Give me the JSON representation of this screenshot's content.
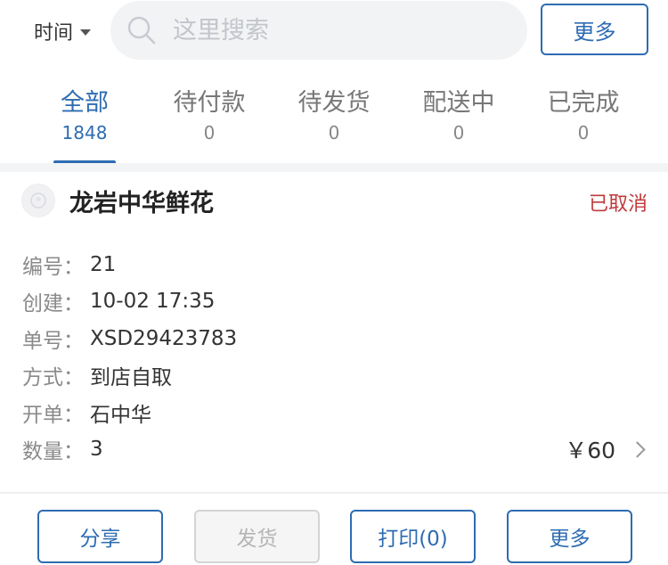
{
  "topbar": {
    "time_filter_label": "时间",
    "search_placeholder": "这里搜索",
    "more_label": "更多"
  },
  "tabs": [
    {
      "label": "全部",
      "count": "1848",
      "active": true
    },
    {
      "label": "待付款",
      "count": "0",
      "active": false
    },
    {
      "label": "待发货",
      "count": "0",
      "active": false
    },
    {
      "label": "配送中",
      "count": "0",
      "active": false
    },
    {
      "label": "已完成",
      "count": "0",
      "active": false
    }
  ],
  "order": {
    "store_name": "龙岩中华鲜花",
    "status": "已取消",
    "fields": [
      {
        "key": "编号：",
        "value": "21"
      },
      {
        "key": "创建：",
        "value": "10-02 17:35"
      },
      {
        "key": "单号：",
        "value": "XSD29423783"
      },
      {
        "key": "方式：",
        "value": "到店自取"
      },
      {
        "key": "开单：",
        "value": "石中华"
      },
      {
        "key": "数量：",
        "value": "3"
      }
    ],
    "price": "￥60"
  },
  "actions": {
    "share_label": "分享",
    "ship_label": "发货",
    "print_label": "打印(0)",
    "more_label": "更多"
  },
  "colors": {
    "accent": "#2e6cb2",
    "status_cancelled": "#c0393b",
    "disabled": "#b5b5b5"
  },
  "icons": {
    "search": "search-icon",
    "caret": "caret-down-icon",
    "chevron": "chevron-right-icon",
    "store": "store-avatar-icon"
  }
}
